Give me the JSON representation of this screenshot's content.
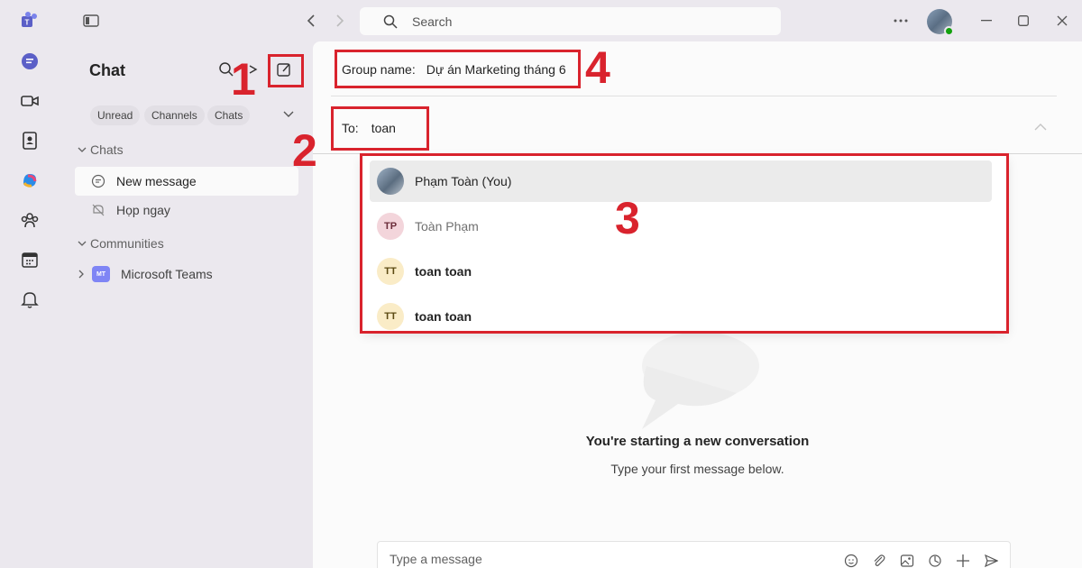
{
  "titlebar": {
    "search_placeholder": "Search"
  },
  "leftpane": {
    "title": "Chat",
    "filters": [
      "Unread",
      "Channels",
      "Chats"
    ],
    "sections": {
      "chats": "Chats",
      "communities": "Communities"
    },
    "chat_items": [
      {
        "label": "New message",
        "active": true
      },
      {
        "label": "Họp ngay",
        "active": false
      }
    ],
    "community_items": [
      {
        "badge": "MT",
        "label": "Microsoft Teams"
      }
    ]
  },
  "main": {
    "group_name_label": "Group name:",
    "group_name_value": "Dự án Marketing tháng 6",
    "to_label": "To:",
    "to_value": "toan",
    "suggestions": [
      {
        "initials": "",
        "name": "Phạm Toàn (You)",
        "photo": true
      },
      {
        "initials": "TP",
        "name": "Toàn Phạm",
        "photo": false
      },
      {
        "initials": "TT",
        "name": "toan toan",
        "photo": false
      },
      {
        "initials": "TT",
        "name": "toan toan",
        "photo": false
      }
    ],
    "empty_title": "You're starting a new conversation",
    "empty_subtitle": "Type your first message below.",
    "compose_placeholder": "Type a message"
  },
  "annotations": [
    "1",
    "2",
    "3",
    "4"
  ],
  "colors": {
    "annotation_red": "#d9232d",
    "teams_purple": "#5b5fc7",
    "presence_green": "#13a10e"
  },
  "icons": [
    "teams-logo-icon",
    "chat-icon",
    "video-icon",
    "contacts-icon",
    "copilot-icon",
    "communities-icon",
    "calendar-icon",
    "bell-icon"
  ]
}
